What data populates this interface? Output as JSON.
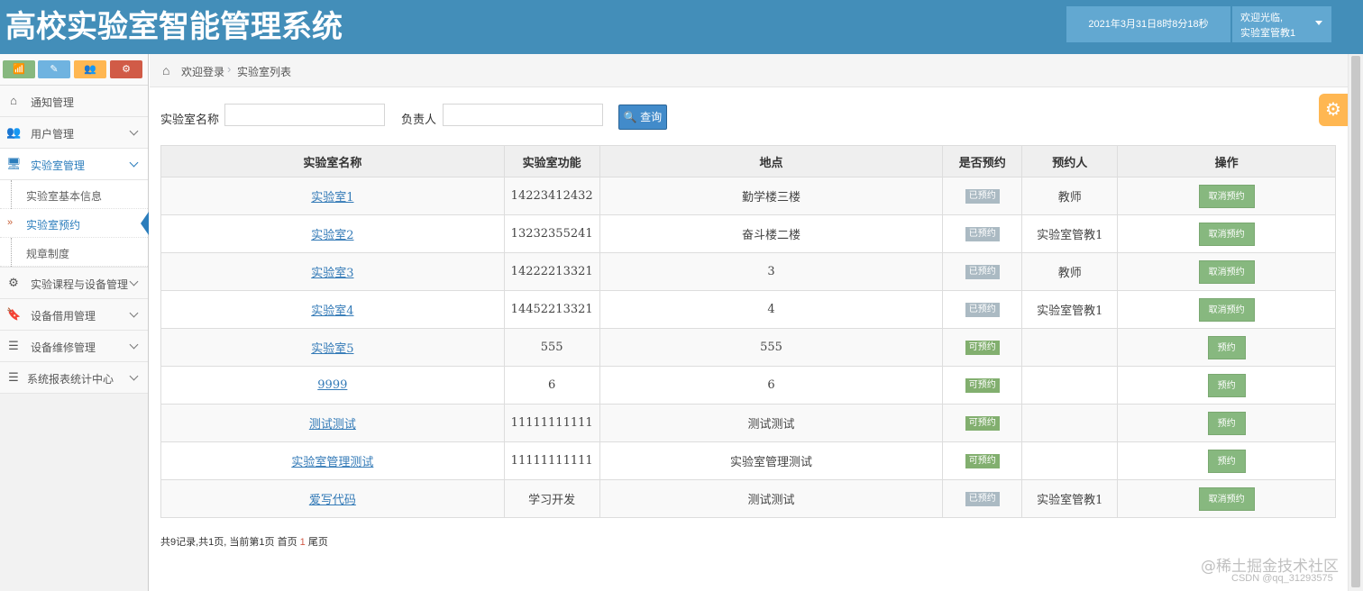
{
  "header": {
    "title": "高校实验室智能管理系统",
    "datetime": "2021年3月31日8时8分18秒",
    "welcome": "欢迎光临,",
    "username": "实验室管教1"
  },
  "shortcuts": {
    "chart": "📶",
    "pencil": "✎",
    "users": "👥",
    "cogs": "⚙"
  },
  "sidebar": {
    "items": [
      {
        "label": "通知管理",
        "icon": "home-icon",
        "glyph": "⌂"
      },
      {
        "label": "用户管理",
        "icon": "users-icon",
        "glyph": "👥"
      },
      {
        "label": "实验室管理",
        "icon": "desktop-icon",
        "glyph": "🖥"
      },
      {
        "label": "实验课程与设备管理",
        "icon": "cogs-icon",
        "glyph": "⚙"
      },
      {
        "label": "设备借用管理",
        "icon": "bookmark-icon",
        "glyph": "🔖"
      },
      {
        "label": "设备维修管理",
        "icon": "list-icon",
        "glyph": "☰"
      },
      {
        "label": "系统报表统计中心",
        "icon": "list-icon",
        "glyph": "☰"
      }
    ],
    "sub_items": [
      {
        "label": "实验室基本信息"
      },
      {
        "label": "实验室预约",
        "arrow": "»"
      },
      {
        "label": "规章制度"
      }
    ]
  },
  "breadcrumb": {
    "home": "欢迎登录",
    "separator": "›",
    "current": "实验室列表"
  },
  "search": {
    "name_label": "实验室名称",
    "owner_label": "负责人",
    "name_value": "",
    "owner_value": "",
    "button_label": "🔍 查询"
  },
  "table": {
    "headers": [
      "实验室名称",
      "实验室功能",
      "地点",
      "是否预约",
      "预约人",
      "操作"
    ],
    "rows": [
      {
        "name": "实验室1",
        "function": "14223412432",
        "location": "勤学楼三楼",
        "status": "已预约",
        "booker": "教师",
        "action": "取消预约"
      },
      {
        "name": "实验室2",
        "function": "13232355241",
        "location": "奋斗楼二楼",
        "status": "已预约",
        "booker": "实验室管教1",
        "action": "取消预约"
      },
      {
        "name": "实验室3",
        "function": "14222213321",
        "location": "3",
        "status": "已预约",
        "booker": "教师",
        "action": "取消预约"
      },
      {
        "name": "实验室4",
        "function": "14452213321",
        "location": "4",
        "status": "已预约",
        "booker": "实验室管教1",
        "action": "取消预约"
      },
      {
        "name": "实验室5",
        "function": "555",
        "location": "555",
        "status": "可预约",
        "booker": "",
        "action": "预约"
      },
      {
        "name": "9999",
        "function": "6",
        "location": "6",
        "status": "可预约",
        "booker": "",
        "action": "预约"
      },
      {
        "name": "测试测试",
        "function": "11111111111",
        "location": "测试测试",
        "status": "可预约",
        "booker": "",
        "action": "预约"
      },
      {
        "name": "实验室管理测试",
        "function": "11111111111",
        "location": "实验室管理测试",
        "status": "可预约",
        "booker": "",
        "action": "预约"
      },
      {
        "name": "爱写代码",
        "function": "学习开发",
        "location": "测试测试",
        "status": "已预约",
        "booker": "实验室管教1",
        "action": "取消预约"
      }
    ]
  },
  "pagination": {
    "summary": "共9记录,共1页, 当前第1页 首页",
    "current": "1",
    "last": "尾页"
  },
  "watermark": {
    "line1": "@稀土掘金技术社区",
    "line2": "CSDN @qq_31293575"
  },
  "colors": {
    "header": "#438eb9",
    "accent": "#2b7dbc",
    "booked_badge": "#abbac3",
    "free_badge": "#82af6f",
    "action_button": "#87b87f"
  }
}
